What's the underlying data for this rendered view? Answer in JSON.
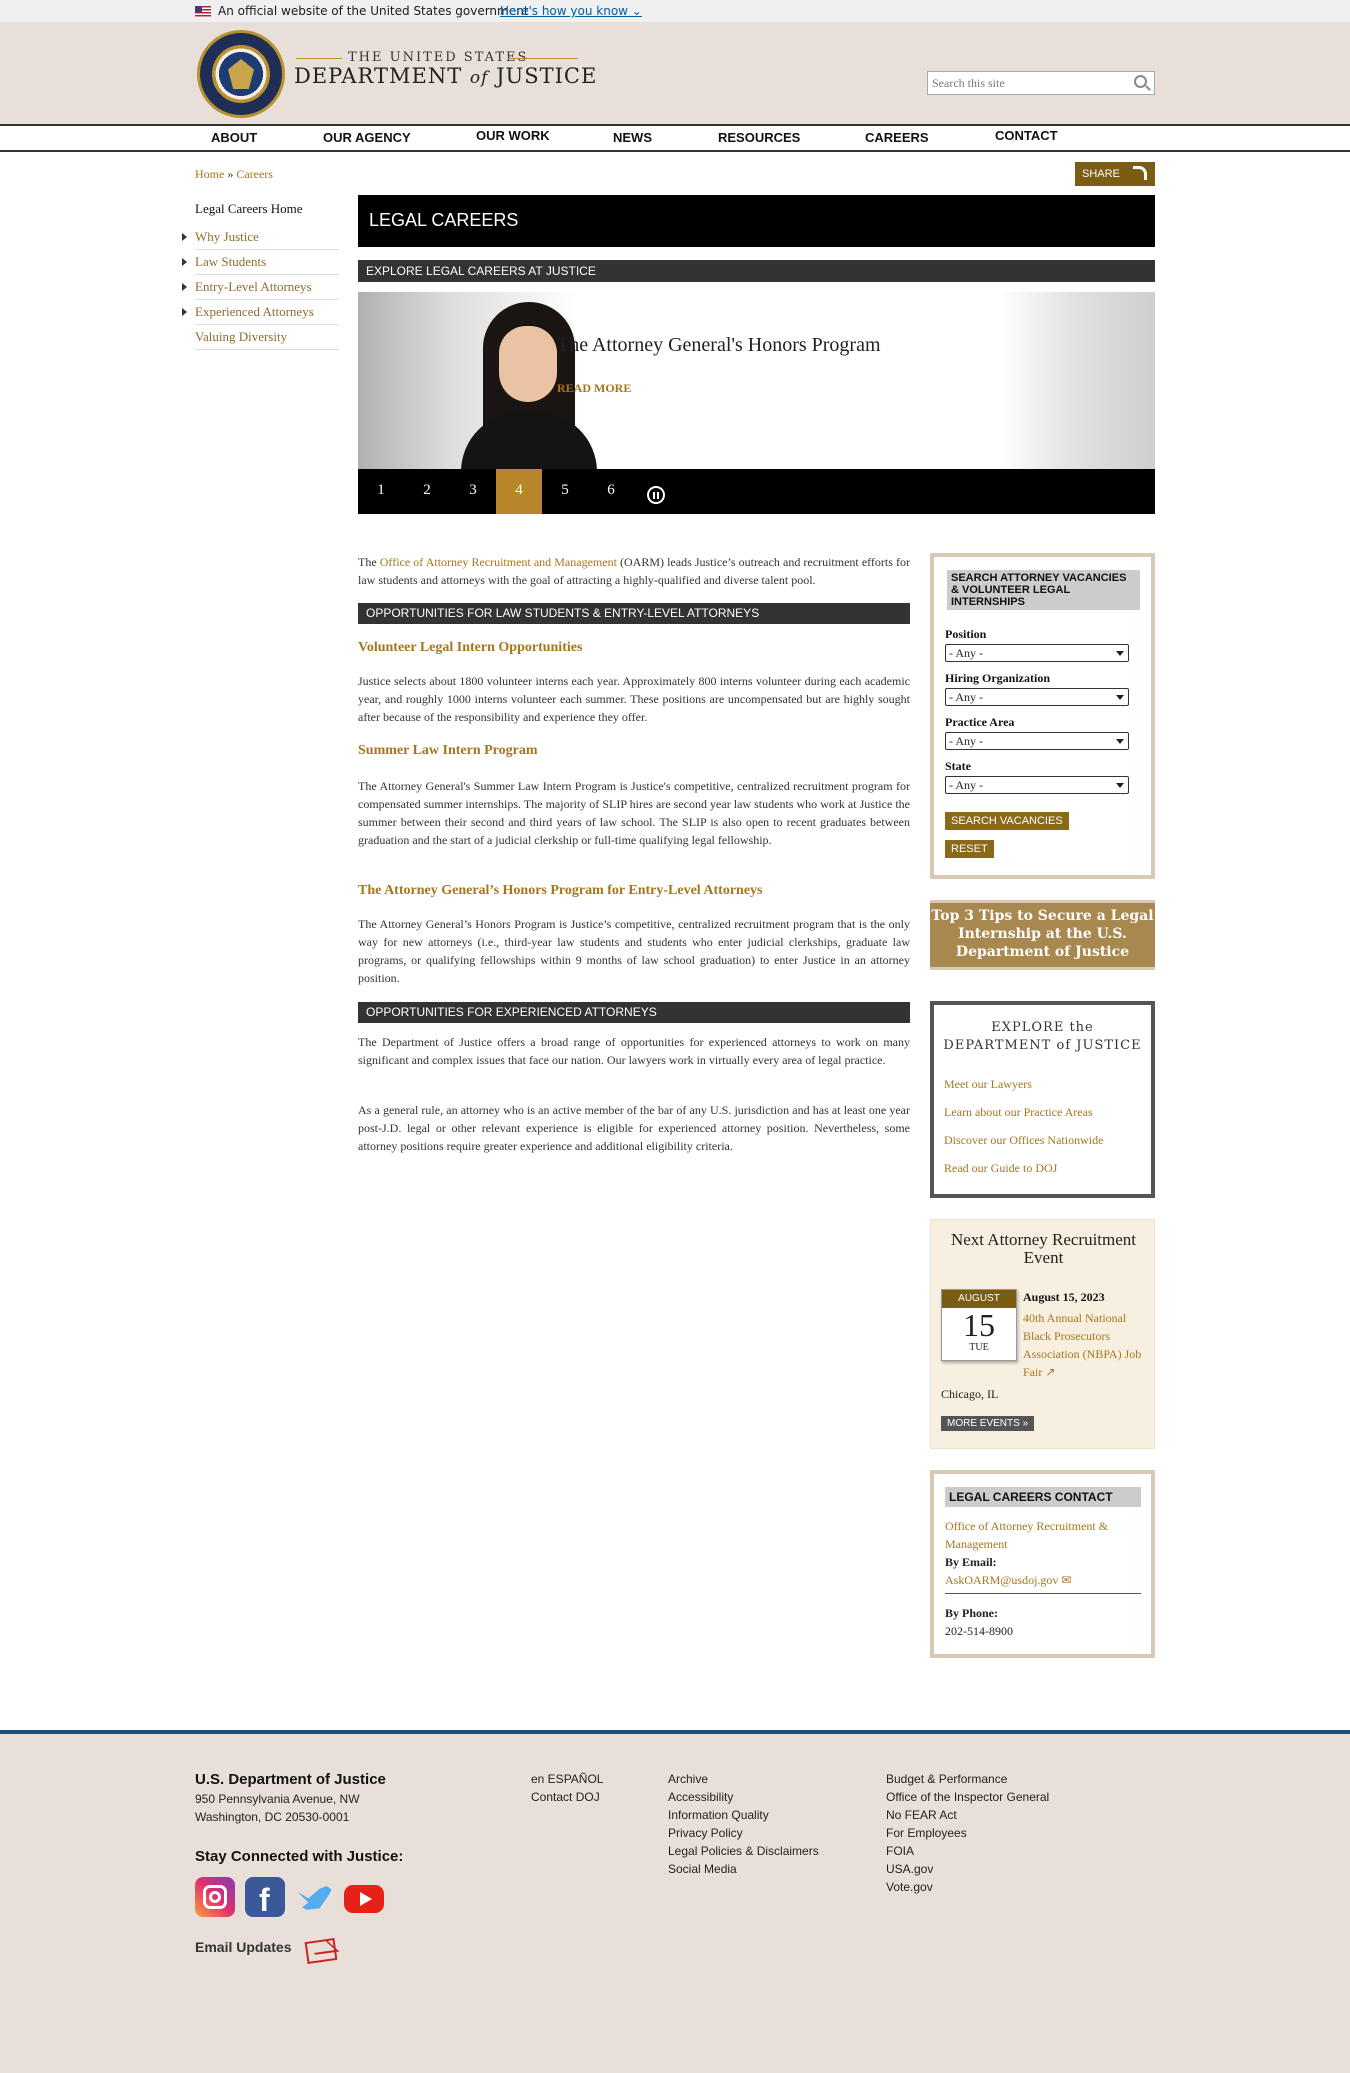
{
  "gov_banner": {
    "text": "An official website of the United States government",
    "how_link": "Here's how you know"
  },
  "header": {
    "logo_line1": "THE UNITED STATES",
    "logo_dept": "DEPARTMENT",
    "logo_of": "of",
    "logo_justice": "JUSTICE",
    "search_placeholder": "Search this site"
  },
  "nav": [
    "ABOUT",
    "OUR AGENCY",
    "OUR WORK",
    "NEWS",
    "RESOURCES",
    "CAREERS",
    "CONTACT"
  ],
  "breadcrumb": {
    "home": "Home",
    "sep": "»",
    "current": "Careers"
  },
  "share_label": "SHARE",
  "sidebar": {
    "heading": "Legal Careers Home",
    "items": [
      "Why Justice",
      "Law Students",
      "Entry-Level Attorneys",
      "Experienced Attorneys",
      "Valuing Diversity"
    ]
  },
  "page_title": "LEGAL CAREERS",
  "explore_bar": "EXPLORE LEGAL CAREERS AT JUSTICE",
  "carousel": {
    "title": "The Attorney General's Honors Program",
    "read_more": "READ MORE",
    "pages": [
      "1",
      "2",
      "3",
      "4",
      "5",
      "6"
    ],
    "active_page": "4"
  },
  "intro": {
    "pre": "The ",
    "link": "Office of Attorney Recruitment and Management",
    "post": " (OARM) leads Justice’s outreach and recruitment efforts for law students and attorneys with the goal of attracting a highly-qualified and diverse talent pool."
  },
  "section1": "OPPORTUNITIES FOR LAW STUDENTS & ENTRY-LEVEL ATTORNEYS",
  "vli": {
    "heading": "Volunteer Legal Intern Opportunities",
    "text": "Justice selects about 1800 volunteer interns each year. Approximately 800 interns volunteer during each academic year, and roughly 1000 interns volunteer each summer. These positions are uncompensated but are highly sought after because of the responsibility and experience they offer."
  },
  "slip": {
    "heading": "Summer Law Intern Program",
    "text": "The Attorney General's Summer Law Intern Program is Justice's competitive, centralized recruitment program for compensated summer internships.  The majority of SLIP hires are second year law students who work at Justice the summer between their second and third years of law school.  The SLIP is also open to recent graduates between graduation and the start of a judicial clerkship or full-time qualifying legal fellowship."
  },
  "honors": {
    "heading": "The Attorney General’s Honors Program for Entry-Level Attorneys",
    "text": "The Attorney General’s Honors Program is Justice’s competitive, centralized recruitment program that is the only way for new attorneys (i.e., third-year law students and students who enter judicial clerkships, graduate law programs, or qualifying fellowships within 9 months of law school graduation) to enter Justice in an attorney position."
  },
  "section2": "OPPORTUNITIES FOR EXPERIENCED ATTORNEYS",
  "exp_p1": "The Department of Justice offers a broad range of opportunities for experienced attorneys to work on many significant and complex issues that face our nation. Our lawyers work in virtually every area of legal practice.",
  "exp_p2": "As a general rule, an attorney who is an active member of the bar of any U.S. jurisdiction and has at least one year post-J.D. legal or other relevant experience is eligible for experienced attorney position. Nevertheless, some attorney positions require greater experience and additional eligibility criteria.",
  "vacancies": {
    "heading": "SEARCH ATTORNEY VACANCIES & VOLUNTEER LEGAL INTERNSHIPS",
    "fields": [
      {
        "label": "Position",
        "value": "- Any -"
      },
      {
        "label": "Hiring Organization",
        "value": "- Any -"
      },
      {
        "label": "Practice Area",
        "value": "- Any -"
      },
      {
        "label": "State",
        "value": "- Any -"
      }
    ],
    "search_label": "SEARCH VACANCIES",
    "reset_label": "RESET"
  },
  "tips_banner": "Top 3 Tips to Secure a Legal Internship at the U.S. Department of Justice",
  "explore_doj": {
    "title_line1": "EXPLORE the",
    "title_line2": "DEPARTMENT of JUSTICE",
    "links": [
      "Meet our Lawyers",
      "Learn about our Practice Areas",
      "Discover our Offices Nationwide",
      "Read our Guide to DOJ"
    ]
  },
  "event": {
    "heading": "Next Attorney Recruitment Event",
    "month": "AUGUST",
    "day": "15",
    "dow": "TUE",
    "date": "August 15, 2023",
    "name": "40th Annual National Black Prosecutors Association (NBPA) Job Fair",
    "location": "Chicago, IL",
    "more": "MORE EVENTS »"
  },
  "contact": {
    "heading": "LEGAL CAREERS CONTACT",
    "office": "Office of Attorney Recruitment & Management",
    "email_label": "By Email:",
    "email": "AskOARM@usdoj.gov",
    "phone_label": "By Phone:",
    "phone": "202-514-8900"
  },
  "footer": {
    "org": "U.S. Department of Justice",
    "addr1": "950 Pennsylvania Avenue, NW",
    "addr2": "Washington, DC 20530-0001",
    "stay": "Stay Connected with Justice:",
    "email_updates": "Email Updates",
    "col1": [
      "en ESPAÑOL",
      "Contact DOJ"
    ],
    "col2": [
      "Archive",
      "Accessibility",
      "Information Quality",
      "Privacy Policy",
      "Legal Policies & Disclaimers",
      "Social Media"
    ],
    "col3": [
      "Budget & Performance",
      "Office of the Inspector General",
      "No FEAR Act",
      "For Employees",
      "FOIA",
      "USA.gov",
      "Vote.gov"
    ]
  }
}
